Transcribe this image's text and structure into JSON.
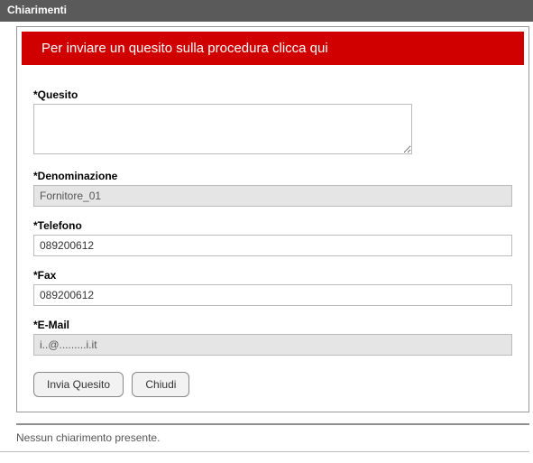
{
  "header": {
    "title": "Chiarimenti"
  },
  "banner": {
    "text": "Per inviare un quesito sulla procedura clicca qui"
  },
  "form": {
    "quesito": {
      "label": "*Quesito",
      "value": ""
    },
    "denominazione": {
      "label": "*Denominazione",
      "value": "Fornitore_01"
    },
    "telefono": {
      "label": "*Telefono",
      "value": "089200612"
    },
    "fax": {
      "label": "*Fax",
      "value": "089200612"
    },
    "email": {
      "label": "*E-Mail",
      "value": "i..@.........i.it"
    }
  },
  "buttons": {
    "submit": "Invia Quesito",
    "close": "Chiudi"
  },
  "footer": {
    "status": "Nessun chiarimento presente."
  }
}
